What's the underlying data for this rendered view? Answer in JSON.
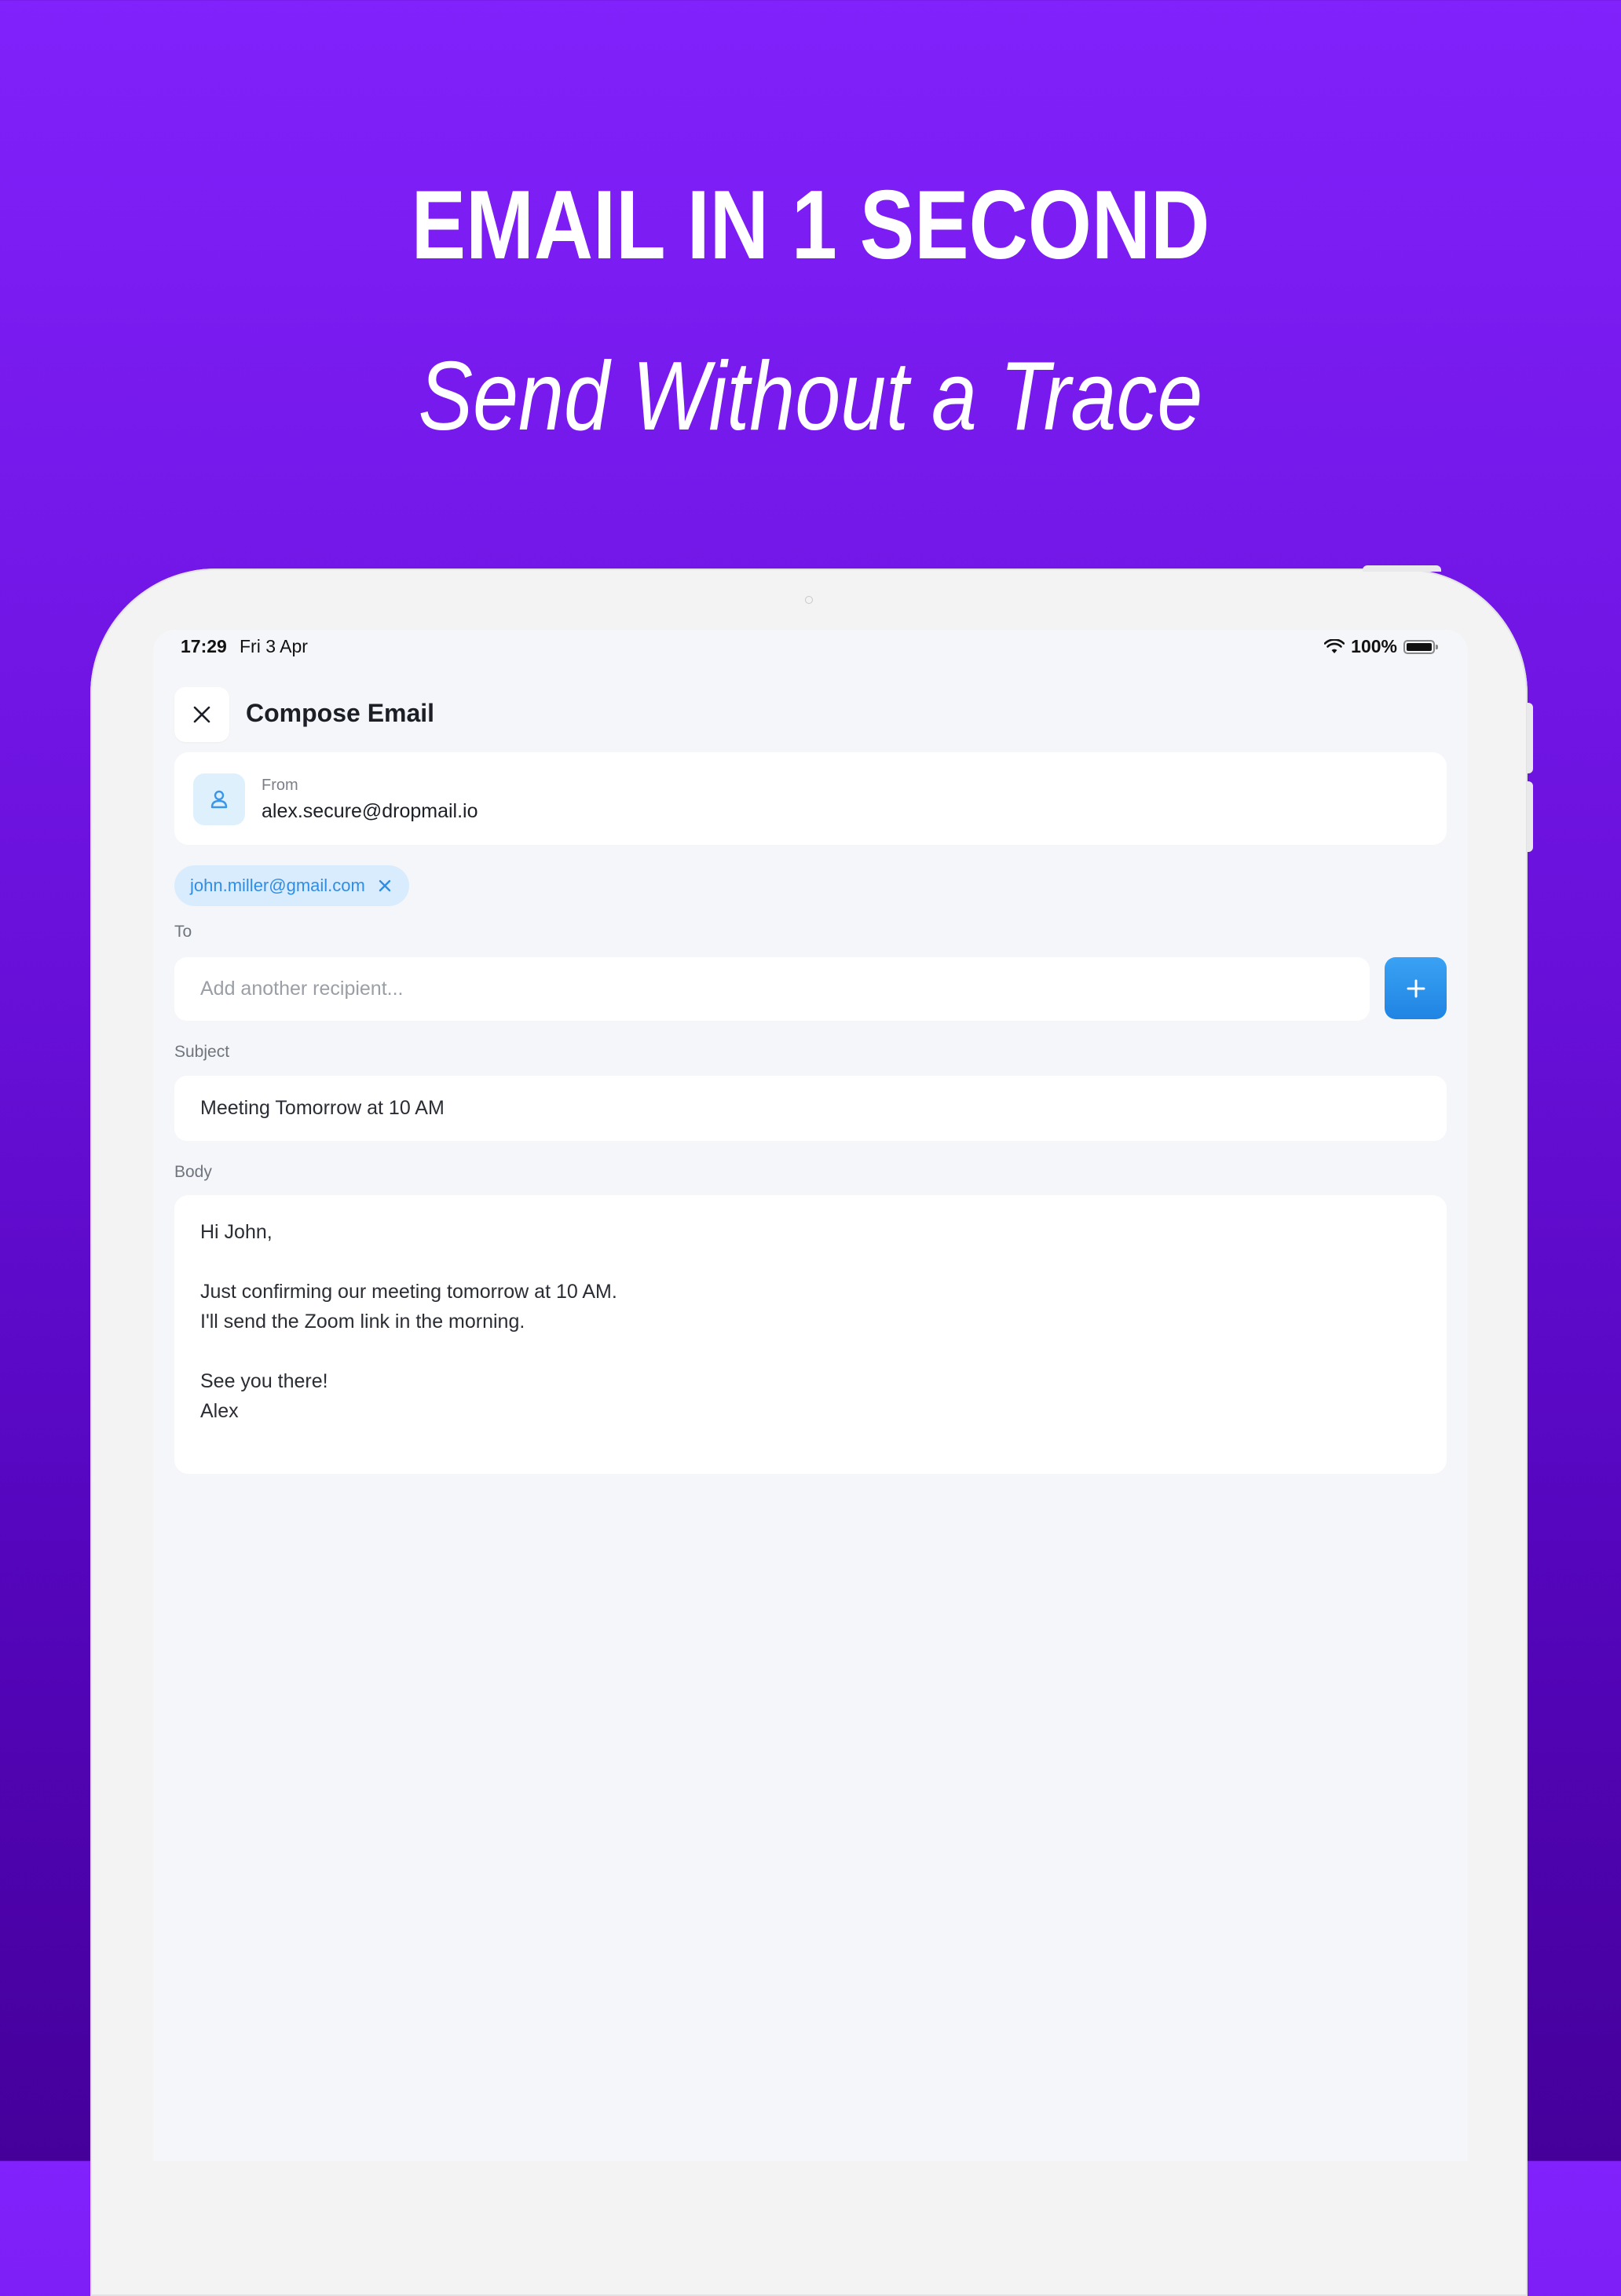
{
  "promo": {
    "headline": "EMAIL IN 1 SECOND",
    "subheadline": "Send Without a Trace"
  },
  "status_bar": {
    "time": "17:29",
    "date": "Fri 3 Apr",
    "battery": "100%"
  },
  "header": {
    "title": "Compose Email",
    "close_icon": "close-icon"
  },
  "from": {
    "label": "From",
    "value": "alex.secure@dropmail.io",
    "icon": "person-icon"
  },
  "recipients": [
    {
      "email": "john.miller@gmail.com"
    }
  ],
  "to": {
    "label": "To",
    "placeholder": "Add another recipient...",
    "add_icon": "plus-icon"
  },
  "subject": {
    "label": "Subject",
    "value": "Meeting Tomorrow at 10 AM"
  },
  "body": {
    "label": "Body",
    "lines": [
      "Hi John,",
      "",
      "Just confirming our meeting tomorrow at 10 AM.",
      "I'll send the Zoom link in the morning.",
      "",
      "See you there!",
      "Alex"
    ]
  },
  "colors": {
    "background_top": "#8121fb",
    "background_bottom": "#45009a",
    "accent": "#2f8de3",
    "chip_bg": "#d9ecfd"
  }
}
